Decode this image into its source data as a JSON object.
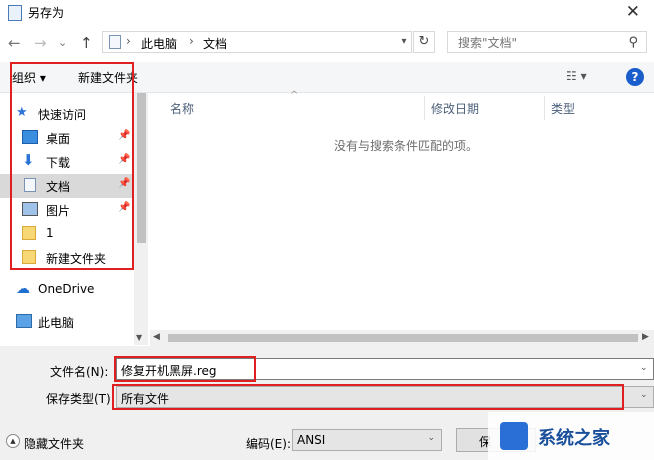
{
  "window": {
    "title": "另存为",
    "close": "✕"
  },
  "nav": {
    "back": "←",
    "forward": "→",
    "recent": "⌄",
    "up": "↑",
    "breadcrumb": [
      "此电脑",
      "文档"
    ],
    "separator": "›",
    "search_placeholder": "搜索\"文档\""
  },
  "toolbar": {
    "organize": "组织 ▾",
    "new_folder": "新建文件夹",
    "view": "☷ ▾",
    "help": "?"
  },
  "sidebar": {
    "items": [
      {
        "label": "快速访问",
        "icon": "star-icon"
      },
      {
        "label": "桌面",
        "icon": "desktop-icon",
        "pinned": true
      },
      {
        "label": "下载",
        "icon": "download-icon",
        "pinned": true
      },
      {
        "label": "文档",
        "icon": "document-icon",
        "pinned": true,
        "selected": true
      },
      {
        "label": "图片",
        "icon": "picture-icon",
        "pinned": true
      },
      {
        "label": "1",
        "icon": "folder-icon"
      },
      {
        "label": "新建文件夹",
        "icon": "folder-icon"
      },
      {
        "label": "OneDrive",
        "icon": "cloud-icon"
      },
      {
        "label": "此电脑",
        "icon": "computer-icon"
      }
    ]
  },
  "content": {
    "columns": [
      "名称",
      "修改日期",
      "类型"
    ],
    "empty_message": "没有与搜索条件匹配的项。"
  },
  "form": {
    "filename_label": "文件名(N):",
    "filename_value": "修复开机黑屏.reg",
    "filetype_label": "保存类型(T):",
    "filetype_value": "所有文件",
    "hide_folders": "隐藏文件夹",
    "encoding_label": "编码(E):",
    "encoding_value": "ANSI",
    "save_button": "保"
  },
  "watermark": {
    "text": "系统之家"
  },
  "colors": {
    "highlight": "#e02020",
    "selected": "#d9d9d9",
    "accent": "#1a5ecb"
  }
}
